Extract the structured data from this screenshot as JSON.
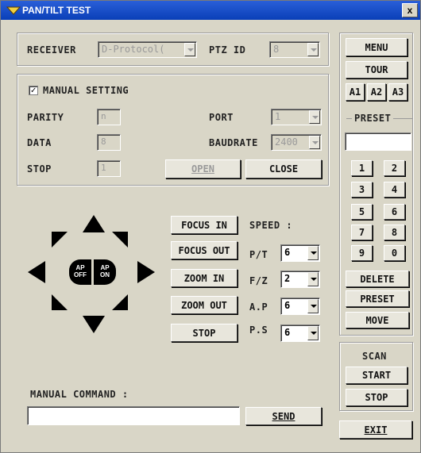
{
  "window": {
    "title": "PAN/TILT TEST",
    "close_glyph": "x"
  },
  "receiver": {
    "label": "RECEIVER",
    "value": "D-Protocol(",
    "ptz_label": "PTZ ID",
    "ptz_value": "8"
  },
  "manual": {
    "checkbox_label": "MANUAL SETTING",
    "checked_glyph": "✓",
    "parity_label": "PARITY",
    "parity_value": "n",
    "data_label": "DATA",
    "data_value": "8",
    "stop_label": "STOP",
    "stop_value": "1",
    "port_label": "PORT",
    "port_value": "1",
    "baud_label": "BAUDRATE",
    "baud_value": "2400",
    "open_label": "OPEN",
    "close_label": "CLOSE"
  },
  "ap": {
    "off_label": "AP\nOFF",
    "on_label": "AP\nON",
    "off_l1": "AP",
    "off_l2": "OFF",
    "on_l1": "AP",
    "on_l2": "ON"
  },
  "controls": {
    "focus_in": "FOCUS IN",
    "focus_out": "FOCUS OUT",
    "zoom_in": "ZOOM IN",
    "zoom_out": "ZOOM OUT",
    "stop": "STOP",
    "speed_label": "SPEED :",
    "pt_label": "P/T",
    "pt_value": "6",
    "fz_label": "F/Z",
    "fz_value": "2",
    "ap_label": "A.P",
    "ap_value": "6",
    "ps_label": "P.S",
    "ps_value": "6"
  },
  "command": {
    "label": "MANUAL COMMAND :",
    "value": "",
    "send_label": "SEND"
  },
  "side": {
    "menu": "MENU",
    "tour": "TOUR",
    "a1": "A1",
    "a2": "A2",
    "a3": "A3",
    "preset_title": "PRESET",
    "preset_value": "",
    "keys": [
      "1",
      "2",
      "3",
      "4",
      "5",
      "6",
      "7",
      "8",
      "9",
      "0"
    ],
    "delete": "DELETE",
    "preset": "PRESET",
    "move": "MOVE",
    "scan_label": "SCAN",
    "start": "START",
    "stop": "STOP",
    "exit": "EXIT"
  }
}
